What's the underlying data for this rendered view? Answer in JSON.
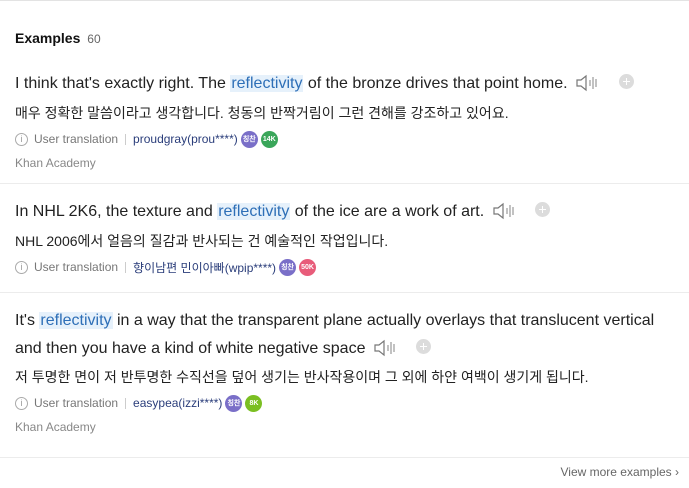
{
  "header": {
    "title": "Examples",
    "count": "60"
  },
  "examples": [
    {
      "en_before": "I think that's exactly right. The ",
      "keyword": "reflectivity",
      "en_after": " of the bronze drives that point home.",
      "ko": "매우 정확한 말씀이라고 생각합니다. 청동의 반짝거림이 그런 견해를 강조하고 있어요.",
      "label": "User translation",
      "user": "proudgray(prou****)",
      "badges": [
        "칭찬",
        "14K"
      ],
      "source": "Khan Academy"
    },
    {
      "en_before": "In NHL 2K6, the texture and ",
      "keyword": "reflectivity",
      "en_after": " of the ice are a work of art.",
      "ko": "NHL 2006에서 얼음의 질감과 반사되는 건 예술적인 작업입니다.",
      "label": "User translation",
      "user": "향이남편 민이아빠(wpip****)",
      "badges": [
        "칭찬",
        "50K"
      ]
    },
    {
      "en_before": "It's ",
      "keyword": "reflectivity",
      "en_after": " in a way that the transparent plane actually overlays that translucent vertical and then you have a kind of white negative space",
      "ko": "저 투명한 면이 저 반투명한 수직선을 덮어 생기는 반사작용이며 그 외에 하얀 여백이 생기게 됩니다.",
      "label": "User translation",
      "user": "easypea(izzi****)",
      "badges": [
        "칭찬",
        "8K"
      ],
      "source": "Khan Academy"
    }
  ],
  "footer": {
    "more": "View more examples ›"
  },
  "colors": {
    "highlight_bg": "#e6f1fb",
    "highlight_text": "#2e6fb7",
    "user_link": "#2a3d7a"
  },
  "icons": [
    "speaker-icon",
    "add-icon",
    "info-icon",
    "chevron-right-icon"
  ]
}
